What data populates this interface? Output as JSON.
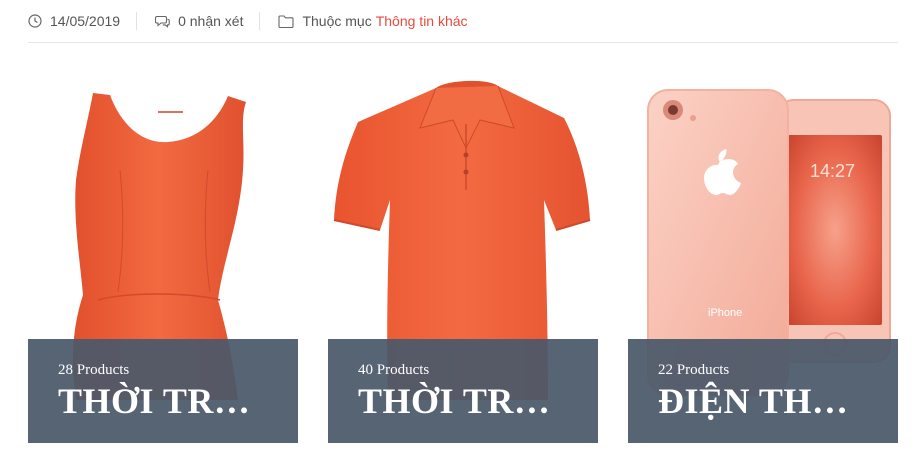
{
  "meta": {
    "date": "14/05/2019",
    "comments": "0 nhận xét",
    "category_prefix": "Thuộc mục",
    "category_link": "Thông tin khác",
    "icons": [
      "clock-icon",
      "comment-icon",
      "folder-icon"
    ],
    "link_color": "#e64b3c"
  },
  "cards": [
    {
      "count": "28 Products",
      "title": "THỜI TR…",
      "image": "orange-sleeveless-top"
    },
    {
      "count": "40 Products",
      "title": "THỜI TR…",
      "image": "orange-polo-shirt"
    },
    {
      "count": "22 Products",
      "title": "ĐIỆN TH…",
      "image": "rose-gold-iphone"
    }
  ],
  "colors": {
    "product_orange": "#f0603a",
    "overlay": "#4a5869"
  }
}
